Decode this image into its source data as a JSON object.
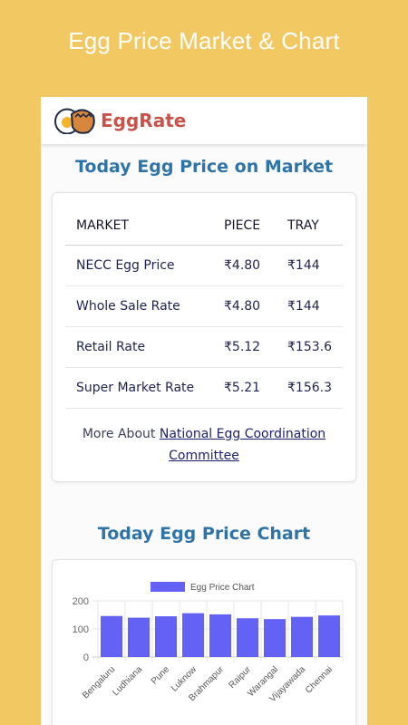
{
  "banner": {
    "title": "Egg Price Market & Chart"
  },
  "app": {
    "name": "EggRate",
    "logo_icon": "eggs-icon"
  },
  "market": {
    "title": "Today Egg Price on Market",
    "headers": [
      "MARKET",
      "PIECE",
      "TRAY"
    ],
    "rows": [
      [
        "NECC Egg Price",
        "₹4.80",
        "₹144"
      ],
      [
        "Whole Sale Rate",
        "₹4.80",
        "₹144"
      ],
      [
        "Retail Rate",
        "₹5.12",
        "₹153.6"
      ],
      [
        "Super Market Rate",
        "₹5.21",
        "₹156.3"
      ]
    ],
    "more_prefix": "More About",
    "more_link": "National Egg Coordination Committee"
  },
  "chart_section": {
    "title": "Today Egg Price Chart"
  },
  "chart_data": {
    "type": "bar",
    "categories": [
      "Bengaluru",
      "Ludhiana",
      "Pune",
      "Luknow",
      "Brahmapur",
      "Raipur",
      "Warangal",
      "Vijayawada",
      "Chennai"
    ],
    "series": [
      {
        "name": "Egg Price Chart",
        "values": [
          146,
          140,
          145,
          156,
          152,
          138,
          135,
          143,
          148
        ]
      }
    ],
    "ylim": [
      0,
      200
    ],
    "yticks": [
      0,
      100,
      200
    ],
    "grid": true,
    "legend": "top",
    "bar_color": "#6461f5"
  }
}
